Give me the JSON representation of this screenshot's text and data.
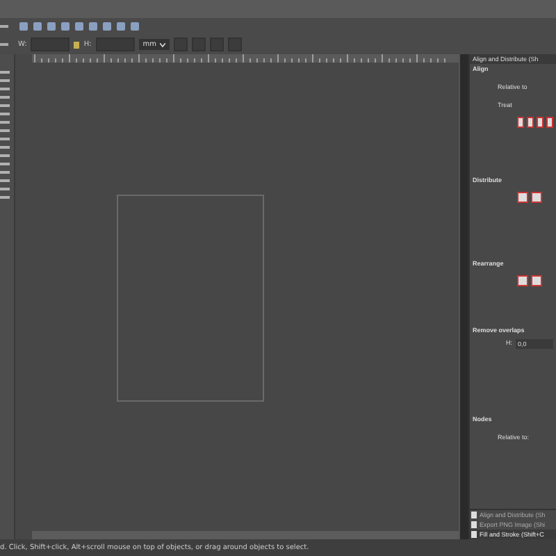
{
  "toolbar": {
    "width_label": "W:",
    "height_label": "H:",
    "unit": "mm"
  },
  "dock": {
    "tab_title": "Align and Distribute (Sh",
    "sections": [
      {
        "kind": "align",
        "title": "Align",
        "lines": [
          "Relative to",
          "Treat"
        ]
      },
      {
        "kind": "distribute",
        "title": "Distribute"
      },
      {
        "kind": "rearrange",
        "title": "Rearrange"
      },
      {
        "kind": "overlap",
        "title": "Remove overlaps",
        "field_label": "H:",
        "field_value": "0,0"
      },
      {
        "kind": "nodes",
        "title": "Nodes",
        "lines": [
          "Relative to:"
        ]
      }
    ],
    "open_dialogs": [
      {
        "label": "Align and Distribute (Sh",
        "selected": false
      },
      {
        "label": "Export PNG Image (Shi",
        "selected": false
      },
      {
        "label": "Fill and Stroke (Shift+C",
        "selected": true
      }
    ]
  },
  "status_bar": {
    "message": "d. Click, Shift+click, Alt+scroll mouse on top of objects, or drag around objects to select."
  }
}
